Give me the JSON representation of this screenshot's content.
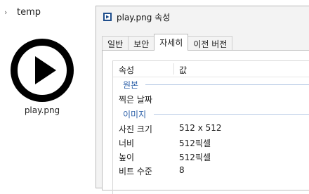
{
  "explorer": {
    "breadcrumb": "temp",
    "file": {
      "name": "play.png",
      "icon": "play-circle-icon"
    }
  },
  "dialog": {
    "title": "play.png 속성",
    "tabs": [
      {
        "label": "일반",
        "active": false
      },
      {
        "label": "보안",
        "active": false
      },
      {
        "label": "자세히",
        "active": true
      },
      {
        "label": "이전 버전",
        "active": false
      }
    ],
    "columns": {
      "property": "속성",
      "value": "값"
    },
    "groups": {
      "origin": {
        "label": "원본",
        "rows": [
          {
            "key": "찍은 날짜",
            "value": ""
          }
        ]
      },
      "image": {
        "label": "이미지",
        "rows": [
          {
            "key": "사진 크기",
            "value": "512 x 512"
          },
          {
            "key": "너비",
            "value": "512픽셀"
          },
          {
            "key": "높이",
            "value": "512픽셀"
          },
          {
            "key": "비트 수준",
            "value": "8"
          }
        ]
      }
    }
  },
  "colors": {
    "group_header": "#2b5fa8",
    "group_rule": "#b9cbe6"
  }
}
